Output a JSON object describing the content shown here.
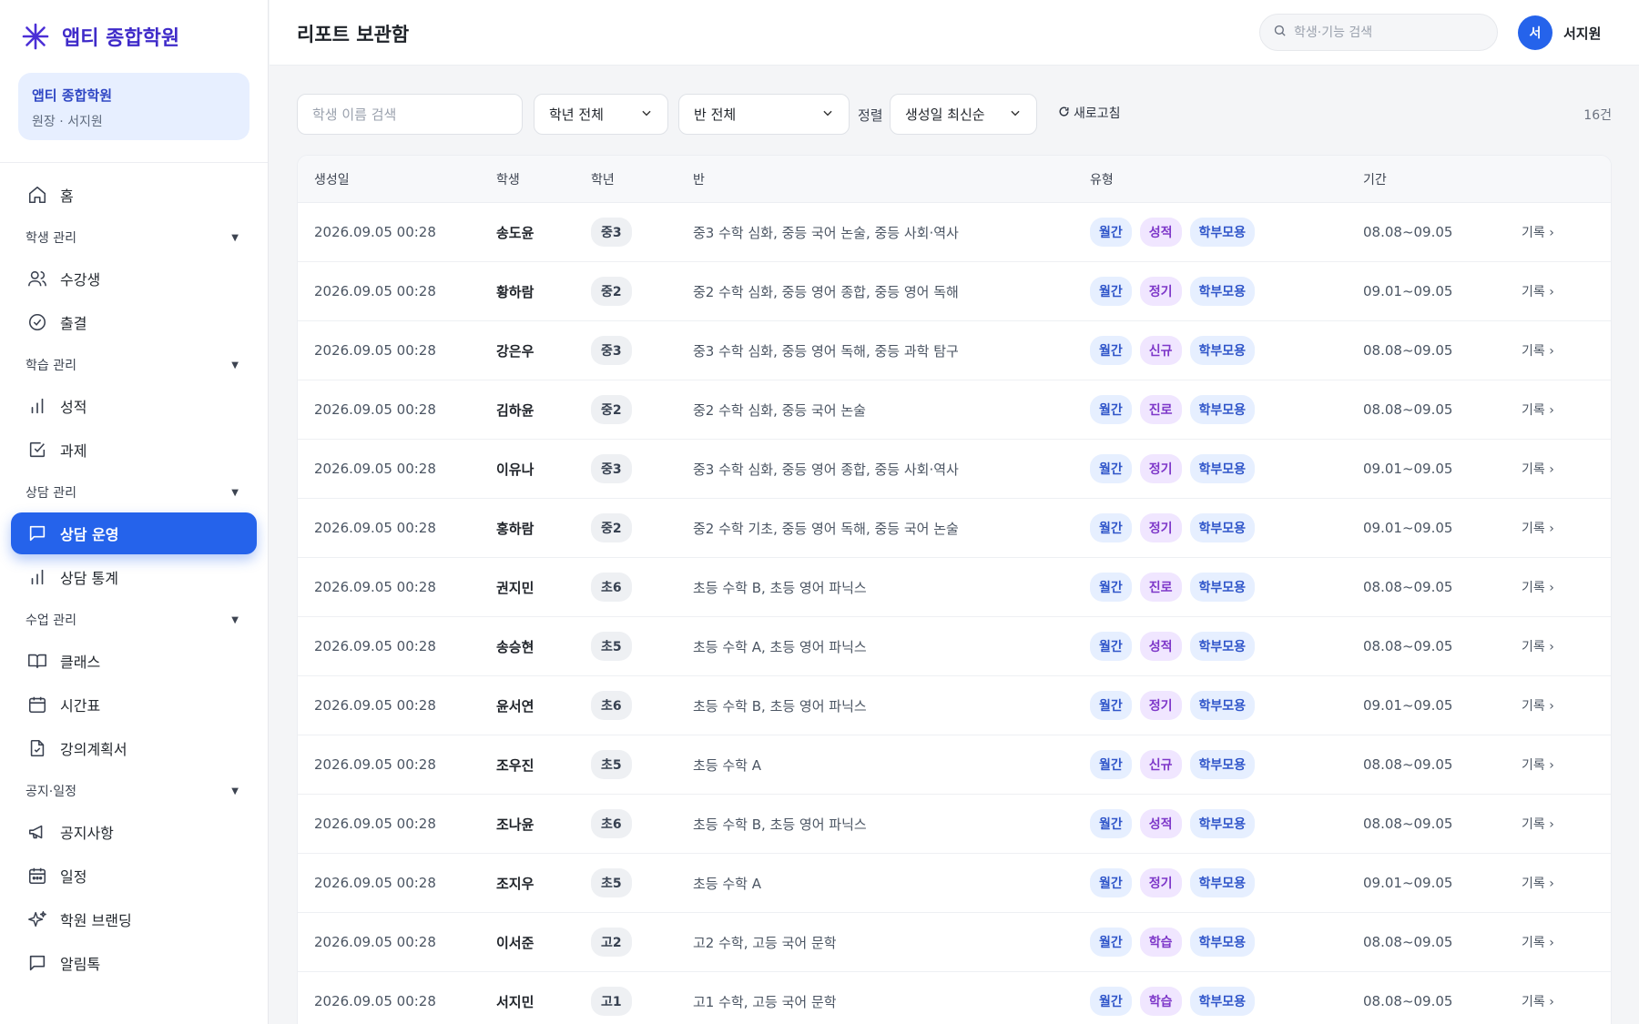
{
  "brand": {
    "name": "앱티 종합학원",
    "logo_icon": "sparkle-icon"
  },
  "org": {
    "name": "앱티 종합학원",
    "role": "원장 · 서지원"
  },
  "colors": {
    "accent": "#2563eb",
    "brand": "#3f2bc9",
    "tag_monthly": "#2f55c9",
    "tag_kind": "#7e38c9"
  },
  "nav": {
    "home": "홈",
    "student_section": "학생 관리",
    "students": "수강생",
    "attendance": "출결",
    "learning_section": "학습 관리",
    "grades": "성적",
    "homework": "과제",
    "counsel_section": "상담 관리",
    "counsel_ops": "상담 운영",
    "counsel_stats": "상담 통계",
    "class_section": "수업 관리",
    "classes": "클래스",
    "timetable": "시간표",
    "syllabus": "강의계획서",
    "notice_section": "공지·일정",
    "notices": "공지사항",
    "schedule": "일정",
    "branding": "학원 브랜딩",
    "alimtalk": "알림톡"
  },
  "header": {
    "title": "리포트 보관함",
    "search_placeholder": "학생·기능 검색",
    "user_initial": "서",
    "user_name": "서지원"
  },
  "filters": {
    "name_placeholder": "학생 이름 검색",
    "grade": "학년 전체",
    "class": "반 전체",
    "sort_label": "정렬",
    "sort": "생성일 최신순",
    "refresh": "새로고침",
    "count": "16건"
  },
  "table": {
    "headers": {
      "date": "생성일",
      "student": "학생",
      "grade": "학년",
      "class": "반",
      "type": "유형",
      "period": "기간"
    },
    "rows": [
      {
        "date": "2026.09.05 00:28",
        "name": "송도윤",
        "grade": "중3",
        "class": "중3 수학 심화, 중등 국어 논술, 중등 사회·역사",
        "t1": "월간",
        "t2": "성적",
        "t3": "학부모용",
        "period": "08.08~09.05",
        "action": "기록 ›"
      },
      {
        "date": "2026.09.05 00:28",
        "name": "황하람",
        "grade": "중2",
        "class": "중2 수학 심화, 중등 영어 종합, 중등 영어 독해",
        "t1": "월간",
        "t2": "정기",
        "t3": "학부모용",
        "period": "09.01~09.05",
        "action": "기록 ›"
      },
      {
        "date": "2026.09.05 00:28",
        "name": "강은우",
        "grade": "중3",
        "class": "중3 수학 심화, 중등 영어 독해, 중등 과학 탐구",
        "t1": "월간",
        "t2": "신규",
        "t3": "학부모용",
        "period": "08.08~09.05",
        "action": "기록 ›"
      },
      {
        "date": "2026.09.05 00:28",
        "name": "김하윤",
        "grade": "중2",
        "class": "중2 수학 심화, 중등 국어 논술",
        "t1": "월간",
        "t2": "진로",
        "t3": "학부모용",
        "period": "08.08~09.05",
        "action": "기록 ›"
      },
      {
        "date": "2026.09.05 00:28",
        "name": "이유나",
        "grade": "중3",
        "class": "중3 수학 심화, 중등 영어 종합, 중등 사회·역사",
        "t1": "월간",
        "t2": "정기",
        "t3": "학부모용",
        "period": "09.01~09.05",
        "action": "기록 ›"
      },
      {
        "date": "2026.09.05 00:28",
        "name": "홍하람",
        "grade": "중2",
        "class": "중2 수학 기초, 중등 영어 독해, 중등 국어 논술",
        "t1": "월간",
        "t2": "정기",
        "t3": "학부모용",
        "period": "09.01~09.05",
        "action": "기록 ›"
      },
      {
        "date": "2026.09.05 00:28",
        "name": "권지민",
        "grade": "초6",
        "class": "초등 수학 B, 초등 영어 파닉스",
        "t1": "월간",
        "t2": "진로",
        "t3": "학부모용",
        "period": "08.08~09.05",
        "action": "기록 ›"
      },
      {
        "date": "2026.09.05 00:28",
        "name": "송승현",
        "grade": "초5",
        "class": "초등 수학 A, 초등 영어 파닉스",
        "t1": "월간",
        "t2": "성적",
        "t3": "학부모용",
        "period": "08.08~09.05",
        "action": "기록 ›"
      },
      {
        "date": "2026.09.05 00:28",
        "name": "윤서연",
        "grade": "초6",
        "class": "초등 수학 B, 초등 영어 파닉스",
        "t1": "월간",
        "t2": "정기",
        "t3": "학부모용",
        "period": "09.01~09.05",
        "action": "기록 ›"
      },
      {
        "date": "2026.09.05 00:28",
        "name": "조우진",
        "grade": "초5",
        "class": "초등 수학 A",
        "t1": "월간",
        "t2": "신규",
        "t3": "학부모용",
        "period": "08.08~09.05",
        "action": "기록 ›"
      },
      {
        "date": "2026.09.05 00:28",
        "name": "조나윤",
        "grade": "초6",
        "class": "초등 수학 B, 초등 영어 파닉스",
        "t1": "월간",
        "t2": "성적",
        "t3": "학부모용",
        "period": "08.08~09.05",
        "action": "기록 ›"
      },
      {
        "date": "2026.09.05 00:28",
        "name": "조지우",
        "grade": "초5",
        "class": "초등 수학 A",
        "t1": "월간",
        "t2": "정기",
        "t3": "학부모용",
        "period": "09.01~09.05",
        "action": "기록 ›"
      },
      {
        "date": "2026.09.05 00:28",
        "name": "이서준",
        "grade": "고2",
        "class": "고2 수학, 고등 국어 문학",
        "t1": "월간",
        "t2": "학습",
        "t3": "학부모용",
        "period": "08.08~09.05",
        "action": "기록 ›"
      },
      {
        "date": "2026.09.05 00:28",
        "name": "서지민",
        "grade": "고1",
        "class": "고1 수학, 고등 국어 문학",
        "t1": "월간",
        "t2": "학습",
        "t3": "학부모용",
        "period": "08.08~09.05",
        "action": "기록 ›"
      }
    ]
  }
}
